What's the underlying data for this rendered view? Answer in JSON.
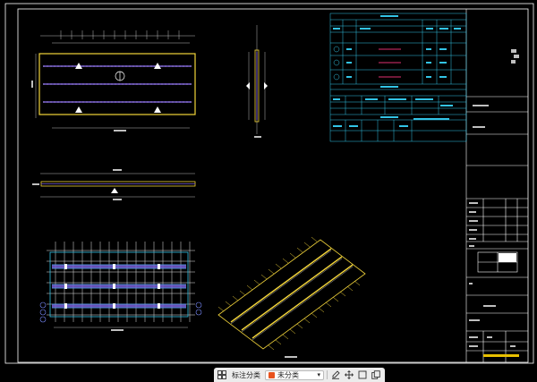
{
  "colors": {
    "background": "#000000",
    "frame": "#ffffff",
    "panel": "#f2d43a",
    "rebar": "#7a5fd8",
    "table": "#33c4e6",
    "grid": "#e6e6e6",
    "highlight": "#e03070",
    "toolbar_accent": "#e8531f"
  },
  "toolbar": {
    "grid_icon": "grid-icon",
    "annotate_label": "标注分类",
    "category_select": "未分类",
    "chevron_icon": "chevron-down-icon",
    "tools": [
      "edit-icon",
      "move-icon",
      "expand-icon",
      "copy-icon"
    ]
  }
}
